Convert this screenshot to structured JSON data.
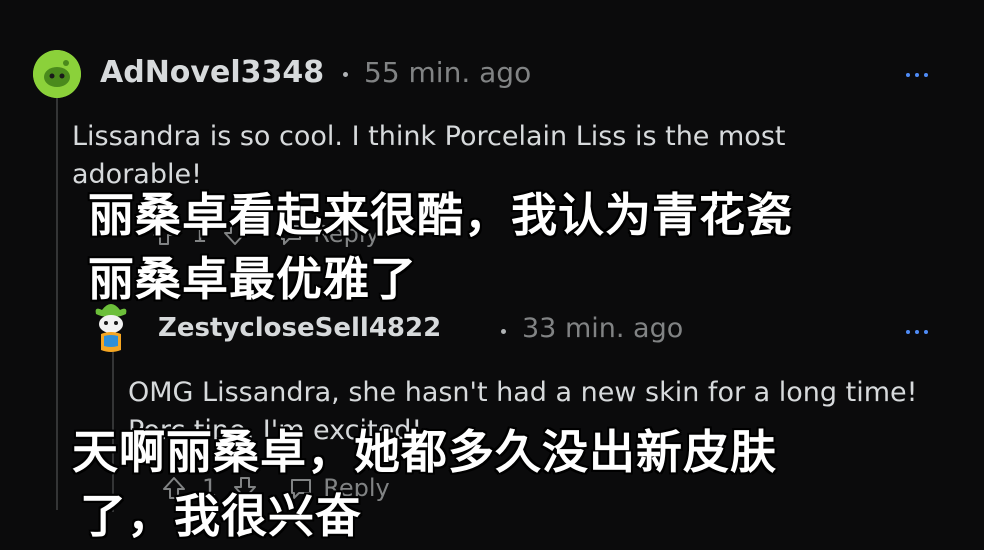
{
  "comments": [
    {
      "username": "AdNovel3348",
      "time": "55 min. ago",
      "body": "Lissandra is so cool. I think Porcelain Liss is the most adorable!",
      "vote_count": "1",
      "reply_label": "Reply"
    },
    {
      "username": "ZestycloseSell4822",
      "time": "33 min. ago",
      "body": "OMG Lissandra, she hasn't had a new skin for a long time! Porc tine, I'm excited!",
      "vote_count": "1",
      "reply_label": "Reply"
    }
  ],
  "subtitles": [
    {
      "line1": "丽桑卓看起来很酷，我认为青花瓷",
      "line2": "丽桑卓最优雅了"
    },
    {
      "line1": "天啊丽桑卓，她都多久没出新皮肤",
      "line2": "了，我很兴奋"
    }
  ],
  "icons": {
    "more": "more-options-icon",
    "upvote": "upvote-arrow-icon",
    "downvote": "downvote-arrow-icon",
    "reply": "reply-bubble-icon"
  },
  "colors": {
    "background": "#0b0b0c",
    "link_blue": "#4f8cf7",
    "avatar_green": "#8bd13a",
    "muted": "#818384"
  }
}
